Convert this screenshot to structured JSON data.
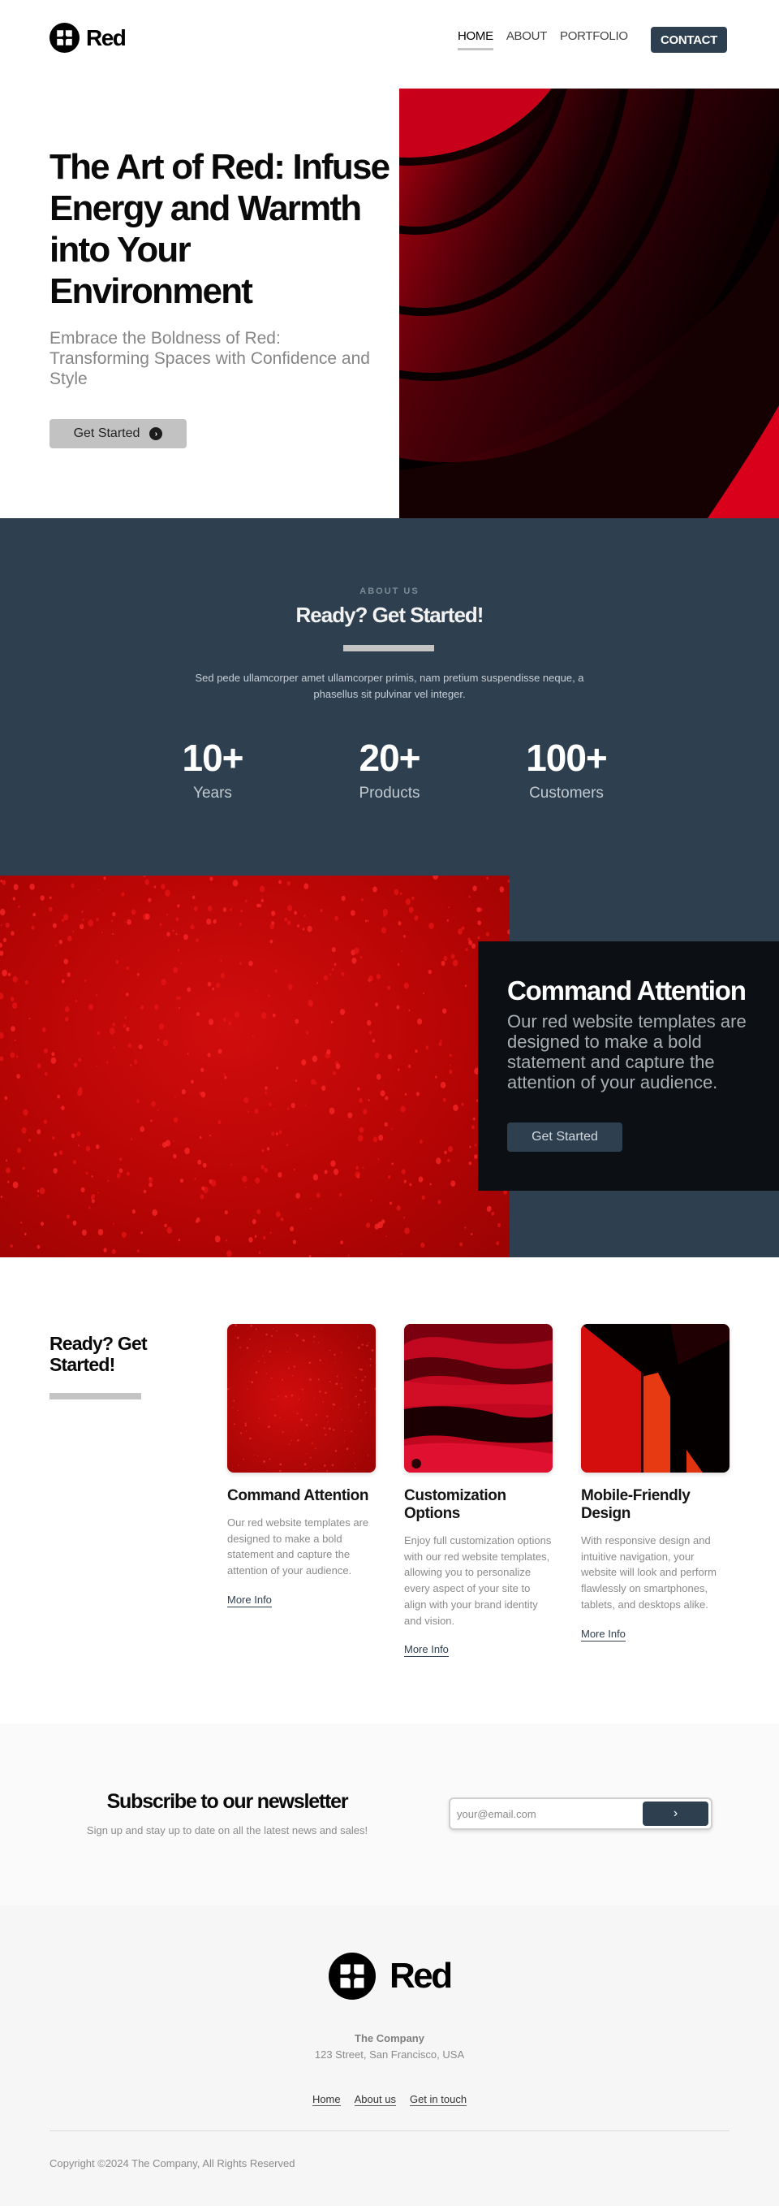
{
  "brand": {
    "name": "Red",
    "logo_icon": "clover-logo-icon"
  },
  "nav": {
    "items": [
      {
        "label": "HOME",
        "active": true
      },
      {
        "label": "ABOUT",
        "active": false
      },
      {
        "label": "PORTFOLIO",
        "active": false
      }
    ],
    "contact_label": "CONTACT"
  },
  "hero": {
    "title": "The Art of Red: Infuse Energy and Warmth into Your Environment",
    "subtitle": "Embrace the Boldness of Red: Transforming Spaces with Confidence and Style",
    "cta_label": "Get Started",
    "cta_icon": "chevron-right-circle-icon",
    "image_alt": "Abstract red concentric curves"
  },
  "about": {
    "eyebrow": "ABOUT US",
    "title": "Ready? Get Started!",
    "text": "Sed pede ullamcorper amet ullamcorper primis, nam pretium suspendisse neque, a phasellus sit pulvinar vel integer.",
    "stats": [
      {
        "value": "10+",
        "label": "Years"
      },
      {
        "value": "20+",
        "label": "Products"
      },
      {
        "value": "100+",
        "label": "Customers"
      }
    ]
  },
  "feature": {
    "image_alt": "Red surface with water drops",
    "title": "Command Attention",
    "text": "Our red website templates are designed to make a bold statement and capture the attention of your audience.",
    "cta_label": "Get Started"
  },
  "cards_section": {
    "title": "Ready? Get Started!",
    "cards": [
      {
        "title": "Command Attention",
        "text": "Our red website templates are designed to make a bold statement and capture the attention of your audience.",
        "link": "More Info",
        "image_alt": "Red water drops"
      },
      {
        "title": "Customization Options",
        "text": "Enjoy full customization options with our red website templates, allowing you to personalize every aspect of your site to align with your brand identity and vision.",
        "link": "More Info",
        "image_alt": "Red textured surface"
      },
      {
        "title": "Mobile-Friendly Design",
        "text": "With responsive design and intuitive navigation, your website will look and perform flawlessly on smartphones, tablets, and desktops alike.",
        "link": "More Info",
        "image_alt": "Red architectural panels"
      }
    ]
  },
  "newsletter": {
    "title": "Subscribe to our newsletter",
    "subtitle": "Sign up and stay up to date on all the latest news and sales!",
    "placeholder": "your@email.com",
    "submit_icon": "chevron-right-icon"
  },
  "footer": {
    "company": "The Company",
    "address": "123 Street, San Francisco, USA",
    "links": [
      "Home",
      "About us",
      "Get in touch"
    ],
    "copyright": "Copyright ©2024 The Company, All Rights Reserved"
  },
  "colors": {
    "primary": "#2e4050",
    "card_dark": "#0c1014",
    "accent_red": "#c00808",
    "muted_bar": "#c4c4c4"
  }
}
